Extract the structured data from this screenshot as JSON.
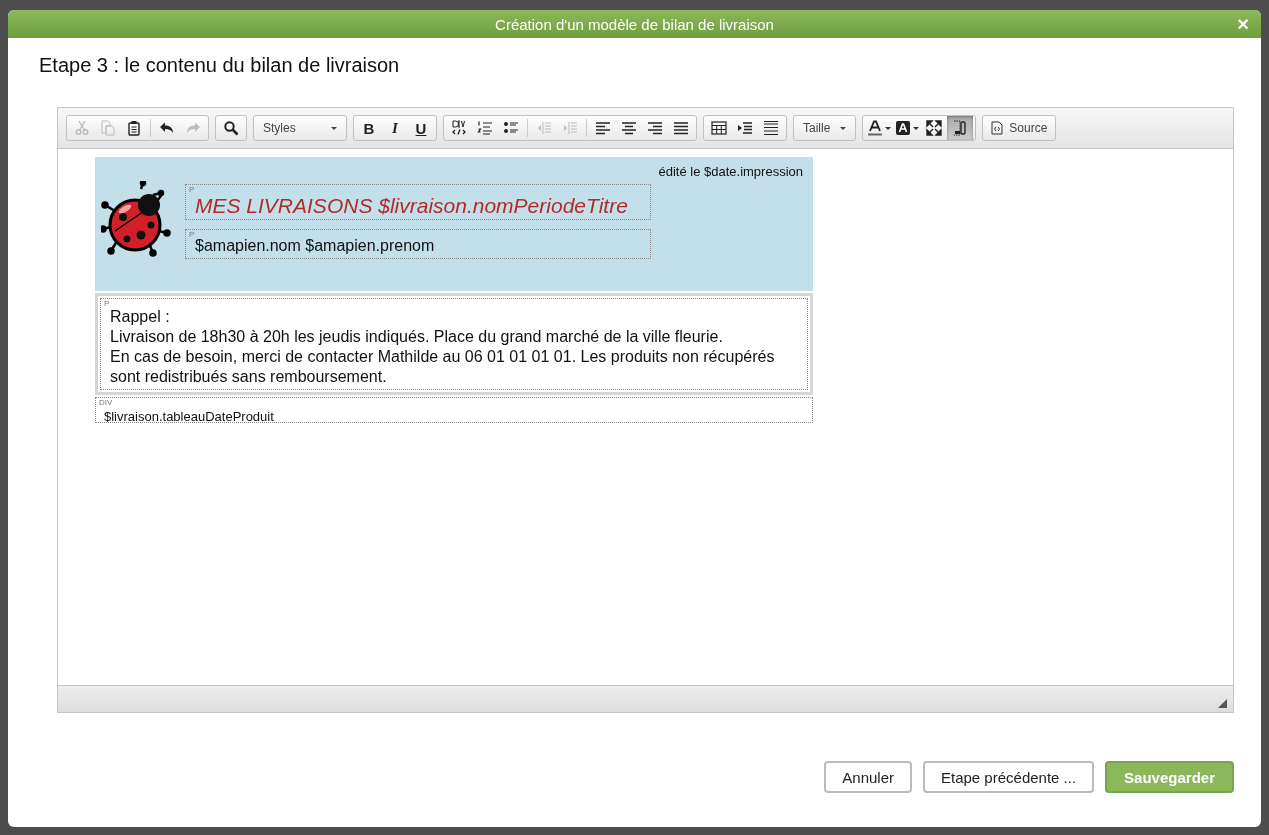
{
  "dialog": {
    "title": "Création d'un modèle de bilan de livraison",
    "close": "×"
  },
  "step_title": "Etape 3 : le contenu du bilan de livraison",
  "toolbar": [
    {
      "items": [
        {
          "kind": "icon",
          "disabled": true
        },
        {
          "kind": "icon",
          "disabled": true
        },
        {
          "kind": "icon",
          "disabled": false
        },
        {
          "kind": "sep"
        },
        {
          "kind": "icon",
          "disabled": false
        },
        {
          "kind": "icon",
          "disabled": true
        }
      ]
    },
    {
      "items": [
        {
          "kind": "icon",
          "disabled": false
        }
      ]
    },
    {
      "items": [
        {
          "kind": "dropdown",
          "label": "Styles"
        }
      ]
    },
    {
      "items": [
        {
          "kind": "bold",
          "label": "B"
        },
        {
          "kind": "italic",
          "label": "I"
        },
        {
          "kind": "underline",
          "label": "U"
        }
      ]
    },
    {
      "items": [
        {
          "kind": "icon",
          "disabled": false
        },
        {
          "kind": "icon",
          "disabled": false
        },
        {
          "kind": "icon",
          "disabled": false
        },
        {
          "kind": "sep"
        },
        {
          "kind": "icon",
          "disabled": true
        },
        {
          "kind": "icon",
          "disabled": true
        },
        {
          "kind": "sep"
        },
        {
          "kind": "icon",
          "disabled": false
        },
        {
          "kind": "icon",
          "disabled": false
        },
        {
          "kind": "icon",
          "disabled": false
        },
        {
          "kind": "icon",
          "disabled": false
        }
      ]
    },
    {
      "items": [
        {
          "kind": "icon",
          "disabled": false
        },
        {
          "kind": "icon",
          "disabled": false
        },
        {
          "kind": "icon",
          "disabled": false
        }
      ]
    },
    {
      "items": [
        {
          "kind": "dropdown",
          "label": "Taille"
        }
      ]
    },
    {
      "items": [
        {
          "kind": "icon",
          "disabled": false
        },
        {
          "kind": "icon",
          "disabled": false
        },
        {
          "kind": "icon",
          "disabled": false
        },
        {
          "kind": "icon",
          "disabled": false,
          "selected": true
        }
      ]
    },
    {
      "items": [
        {
          "kind": "text",
          "label": "Source"
        }
      ]
    }
  ],
  "document": {
    "edited": "édité le $date.impression",
    "title_block": {
      "marker": "P",
      "text": "MES LIVRAISONS $livraison.nomPeriodeTitre"
    },
    "name_block": {
      "marker": "P",
      "text": "$amapien.nom $amapien.prenom"
    },
    "reminder": {
      "marker": "P",
      "lines": [
        "Rappel :",
        "Livraison de 18h30 à 20h les jeudis indiqués. Place du grand marché de la ville fleurie.",
        "En cas de besoin, merci de contacter Mathilde au 06 01 01 01 01. Les produits non récupérés sont redistribués sans remboursement."
      ]
    },
    "table_block": {
      "marker": "DIV",
      "text": "$livraison.tableauDateProduit"
    }
  },
  "buttons": [
    {
      "label": "Annuler",
      "kind": "secondary"
    },
    {
      "label": "Etape précédente ...",
      "kind": "secondary"
    },
    {
      "label": "Sauvegarder",
      "kind": "primary"
    }
  ]
}
